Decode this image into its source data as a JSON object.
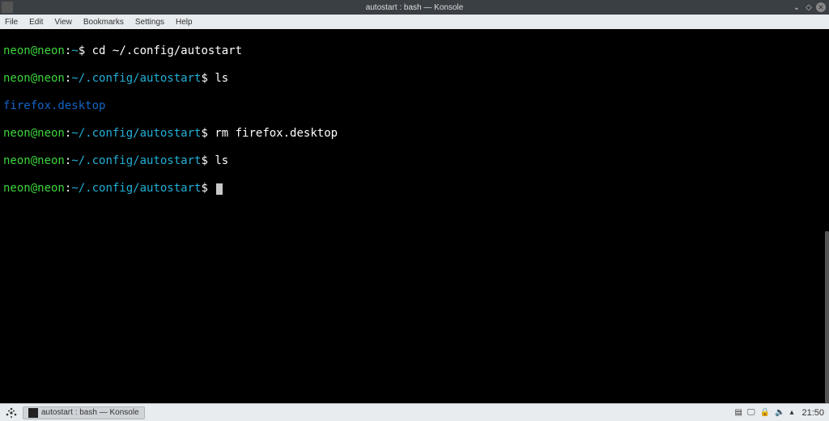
{
  "titlebar": {
    "title": "autostart : bash — Konsole"
  },
  "menubar": {
    "items": [
      "File",
      "Edit",
      "View",
      "Bookmarks",
      "Settings",
      "Help"
    ]
  },
  "terminal": {
    "prompt_user": "neon@neon",
    "prompt_sep1": ":",
    "prompt_end": "$",
    "lines": [
      {
        "path": "~",
        "command": "cd ~/.config/autostart"
      },
      {
        "path": "~/.config/autostart",
        "command": "ls"
      },
      {
        "output": "firefox.desktop"
      },
      {
        "path": "~/.config/autostart",
        "command": "rm firefox.desktop"
      },
      {
        "path": "~/.config/autostart",
        "command": "ls"
      },
      {
        "path": "~/.config/autostart",
        "command": "",
        "cursor": true
      }
    ]
  },
  "taskbar": {
    "task_label": "autostart : bash — Konsole",
    "clock": "21:50"
  }
}
